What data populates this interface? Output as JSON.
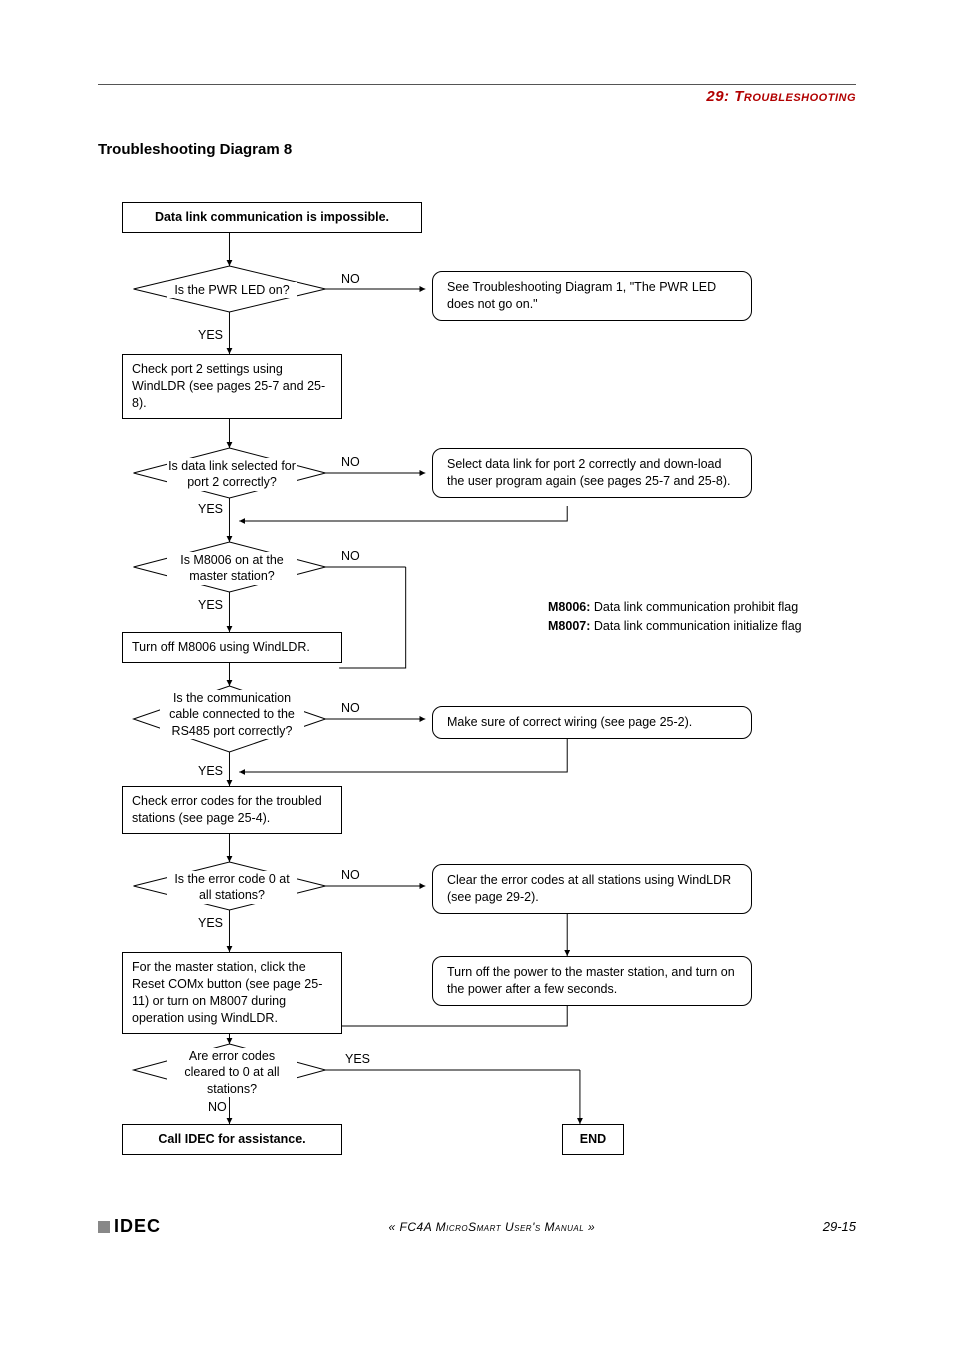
{
  "chapter": {
    "num": "29:",
    "label": "Troubleshooting"
  },
  "section_title": "Troubleshooting Diagram 8",
  "start": "Data link communication is impossible.",
  "d1": {
    "q": "Is the PWR LED on?",
    "yes": "YES",
    "no": "NO"
  },
  "n1": "See Troubleshooting Diagram 1, \"The PWR LED does not go on.\"",
  "p1": "Check port 2 settings using WindLDR (see pages 25-7 and 25-8).",
  "d2": {
    "q": "Is data link selected for port 2 correctly?",
    "yes": "YES",
    "no": "NO"
  },
  "n2": "Select data link for port 2 correctly and down-load the user program again (see pages 25-7 and 25-8).",
  "d3": {
    "q": "Is M8006 on at the master station?",
    "yes": "YES",
    "no": "NO"
  },
  "p3": "Turn off M8006 using WindLDR.",
  "flags": {
    "a": "M8006:",
    "at": "Data link communication prohibit flag",
    "b": "M8007:",
    "bt": "Data link communication initialize flag"
  },
  "d4": {
    "q": "Is the communication cable connected to the RS485 port correctly?",
    "yes": "YES",
    "no": "NO"
  },
  "n4": "Make sure of correct wiring (see page 25-2).",
  "p4": "Check error codes for the troubled stations (see page 25-4).",
  "d5": {
    "q": "Is the error code 0 at all stations?",
    "yes": "YES",
    "no": "NO"
  },
  "n5": "Clear the error codes at all stations using WindLDR (see page 29-2).",
  "p5": "For the master station, click the Reset COMx button (see page 25-11) or turn on M8007 during operation using WindLDR.",
  "n5b": "Turn off the power to the master station, and turn on the power after a few seconds.",
  "d6": {
    "q": "Are error codes cleared to 0 at all stations?",
    "yes": "YES",
    "no": "NO"
  },
  "end_call": "Call IDEC for assistance.",
  "end": "END",
  "footer": {
    "brand": "IDEC",
    "manual": "« FC4A MicroSmart User's Manual »",
    "page": "29-15"
  }
}
